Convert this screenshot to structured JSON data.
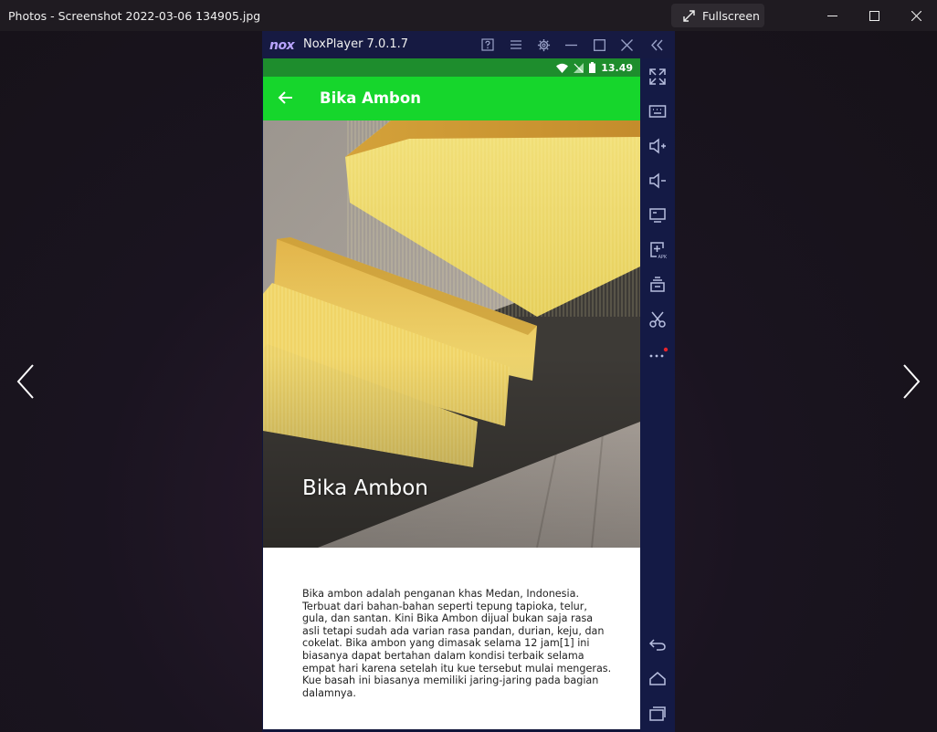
{
  "window": {
    "title": "Photos - Screenshot 2022-03-06 134905.jpg",
    "fullscreen_label": "Fullscreen"
  },
  "nox": {
    "logo": "nox",
    "title": "NoxPlayer 7.0.1.7"
  },
  "phone": {
    "status_time": "13.49",
    "appbar_title": "Bika Ambon",
    "hero_caption": "Bika Ambon",
    "description": "Bika ambon adalah penganan khas Medan, Indonesia. Terbuat dari bahan-bahan seperti tepung tapioka, telur, gula, dan santan. Kini Bika Ambon dijual bukan saja rasa asli tetapi sudah ada varian rasa pandan, durian, keju, dan cokelat. Bika ambon yang dimasak selama 12 jam[1] ini biasanya dapat bertahan dalam kondisi terbaik selama empat hari karena setelah itu kue tersebut mulai mengeras. Kue basah ini biasanya memiliki jaring-jaring pada bagian dalamnya."
  },
  "colors": {
    "appbar": "#16d62c",
    "statusbar": "#1e8d2d",
    "nox_sidebar": "#141a45"
  }
}
